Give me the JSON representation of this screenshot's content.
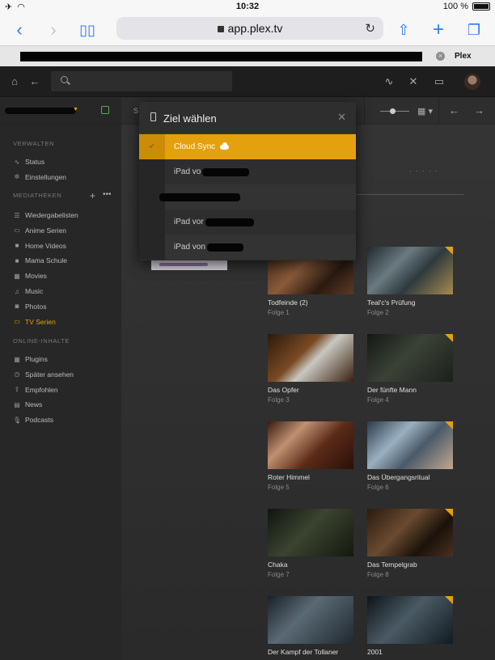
{
  "status_bar": {
    "time": "10:32",
    "battery": "100 %"
  },
  "safari": {
    "url": "app.plex.tv",
    "tab_title": "Plex"
  },
  "sidebar": {
    "sections": [
      {
        "title": "VERWALTEN",
        "items": [
          {
            "label": "Status",
            "icon": "pulse-icon",
            "glyph": "∿"
          },
          {
            "label": "Einstellungen",
            "icon": "gear-icon",
            "glyph": "✲"
          }
        ]
      },
      {
        "title": "MEDIATHEKEN",
        "items": [
          {
            "label": "Wiedergabelisten",
            "icon": "list-icon",
            "glyph": "☰"
          },
          {
            "label": "Anime Serien",
            "icon": "monitor-icon",
            "glyph": "▭"
          },
          {
            "label": "Home Videos",
            "icon": "camera-icon",
            "glyph": "■"
          },
          {
            "label": "Mama Schule",
            "icon": "camera-icon",
            "glyph": "■"
          },
          {
            "label": "Movies",
            "icon": "film-icon",
            "glyph": "▦"
          },
          {
            "label": "Music",
            "icon": "music-icon",
            "glyph": "♫"
          },
          {
            "label": "Photos",
            "icon": "photo-icon",
            "glyph": "◙"
          },
          {
            "label": "TV Serien",
            "icon": "tv-icon",
            "glyph": "▭",
            "active": true
          }
        ]
      },
      {
        "title": "ONLINE-INHALTE",
        "items": [
          {
            "label": "Plugins",
            "icon": "grid-icon",
            "glyph": "▦"
          },
          {
            "label": "Später ansehen",
            "icon": "clock-icon",
            "glyph": "◷"
          },
          {
            "label": "Empfohlen",
            "icon": "share-icon",
            "glyph": "⇧"
          },
          {
            "label": "News",
            "icon": "newspaper-icon",
            "glyph": "▤"
          },
          {
            "label": "Podcasts",
            "icon": "mic-icon",
            "glyph": "🎙"
          }
        ]
      }
    ]
  },
  "toolbar": {
    "partial_label": "S"
  },
  "modal": {
    "title": "Ziel wählen",
    "options": [
      {
        "label": "Cloud Sync",
        "selected": true,
        "cloud": true
      },
      {
        "label": "iPad vo"
      },
      {
        "label": ""
      },
      {
        "label": "iPad vor"
      },
      {
        "label": "iPad von"
      }
    ]
  },
  "episodes": [
    {
      "title": "Todfeinde (2)",
      "subtitle": "Folge 1"
    },
    {
      "title": "Teal'c's Prüfung",
      "subtitle": "Folge 2"
    },
    {
      "title": "Das Opfer",
      "subtitle": "Folge 3"
    },
    {
      "title": "Der fünfte Mann",
      "subtitle": "Folge 4"
    },
    {
      "title": "Roter Himmel",
      "subtitle": "Folge 5"
    },
    {
      "title": "Das Übergangsritual",
      "subtitle": "Folge 6"
    },
    {
      "title": "Chaka",
      "subtitle": "Folge 7"
    },
    {
      "title": "Das Tempelgrab",
      "subtitle": "Folge 8"
    },
    {
      "title": "Der Kampf der Tollaner",
      "subtitle": ""
    },
    {
      "title": "2001",
      "subtitle": ""
    }
  ],
  "colors": {
    "accent": "#e5a00d",
    "ios_blue": "#2f7bf6"
  }
}
